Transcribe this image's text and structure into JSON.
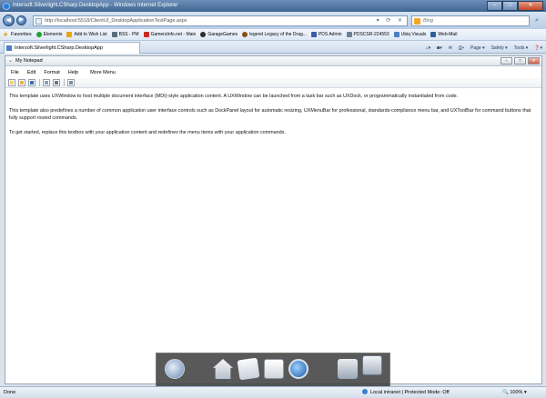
{
  "window": {
    "title": "Intersoft.Silverlight.CSharp.DesktopApp - Windows Internet Explorer",
    "minimize": "–",
    "maximize": "□",
    "close": "✕"
  },
  "nav": {
    "back": "◀",
    "forward": "▶",
    "url": "http://localhost:5518/ClientUI_DesktopApplicationTestPage.aspx",
    "tools": "▾ ⟳ ✕",
    "search_placeholder": "Bing",
    "search_go": "⌕"
  },
  "favorites_bar": {
    "favorites": "Favorites",
    "items": [
      {
        "label": "Elements",
        "color": "#23a234"
      },
      {
        "label": "Add to Wish List",
        "color": "#e8a317"
      },
      {
        "label": "BSS - PM",
        "color": "#5b6b7c"
      },
      {
        "label": "GamersInfo.net - Main",
        "color": "#cc2a1f"
      },
      {
        "label": "GarageGames",
        "color": "#2c2c2c"
      },
      {
        "label": "legend Legacy of the Drag...",
        "color": "#8a4d1c"
      },
      {
        "label": "PDS Admin",
        "color": "#3a5da3"
      },
      {
        "label": "PDSCSR-224553",
        "color": "#6d7f93"
      },
      {
        "label": "Ubiq Visuals",
        "color": "#4b7fc2"
      },
      {
        "label": "Web-Mail",
        "color": "#2f5f9c"
      }
    ]
  },
  "tab": {
    "label": "Intersoft.Silverlight.CSharp.DesktopApp"
  },
  "command_bar": {
    "page": "Page ▾",
    "safety": "Safety ▾",
    "tools": "Tools ▾",
    "help": "❓▾"
  },
  "notepad": {
    "title": "My Notepad",
    "menu": [
      "File",
      "Edit",
      "Format",
      "Help",
      "More Menu"
    ],
    "toolbar_icons": [
      "new-document-icon",
      "open-folder-icon",
      "save-icon",
      "print-preview-icon",
      "print-icon",
      "properties-icon"
    ],
    "paragraphs": [
      "This template uses UXWindow to host multiple document interface (MDI)-style application content. A UXWindow can be launched from a task bar such as UXDock, or programmatically instantiated from code.",
      "This template also predefines  a number of common application user interface controls such as DockPanel layout for automatic resizing, UXMenuBar for professional, standards-compliance menu bar, and UXToolBar for command buttons that fully support routed commands.",
      "To get started, replace this textbox with your application content and redefines the menu items with your application commands."
    ]
  },
  "status": {
    "left": "Done",
    "zone": "Local intranet | Protected Mode: Off",
    "zoom": "🔍 100% ▾"
  }
}
